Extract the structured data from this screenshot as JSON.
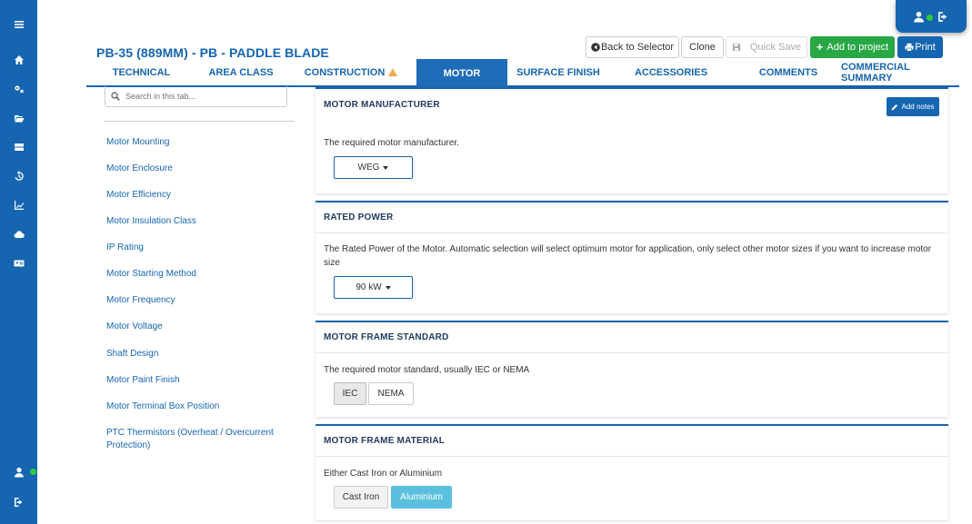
{
  "header": {
    "title": "PB-35 (889MM) - PB - PADDLE BLADE"
  },
  "toolbar": {
    "back_label": "Back to Selector",
    "clone_label": "Clone",
    "quick_save_label": "Quick Save",
    "add_to_project_label": "Add to project",
    "print_label": "Print"
  },
  "tabs": [
    {
      "label": "TECHNICAL"
    },
    {
      "label": "AREA CLASS"
    },
    {
      "label": "CONSTRUCTION"
    },
    {
      "label": "MOTOR"
    },
    {
      "label": "SURFACE FINISH"
    },
    {
      "label": "ACCESSORIES"
    },
    {
      "label": "COMMENTS"
    },
    {
      "label": "COMMERCIAL SUMMARY"
    }
  ],
  "sidebar": {
    "search_placeholder": "Search in this tab...",
    "items": [
      {
        "label": "Motor Mounting"
      },
      {
        "label": "Motor Enclosure"
      },
      {
        "label": "Motor Efficiency"
      },
      {
        "label": "Motor Insulation Class"
      },
      {
        "label": "IP Rating"
      },
      {
        "label": "Motor Starting Method"
      },
      {
        "label": "Motor Frequency"
      },
      {
        "label": "Motor Voltage"
      },
      {
        "label": "Shaft Design"
      },
      {
        "label": "Motor Paint Finish"
      },
      {
        "label": "Motor Terminal Box Position"
      },
      {
        "label": "PTC Thermistors (Overheat / Overcurrent Protection)"
      }
    ]
  },
  "sections": {
    "manufacturer": {
      "title": "MOTOR MANUFACTURER",
      "add_notes_label": "Add notes",
      "description": "The required motor manufacturer.",
      "selected": "WEG"
    },
    "rated_power": {
      "title": "RATED POWER",
      "description": "The Rated Power of the Motor. Automatic selection will select optimum motor for application, only select other motor sizes if you want to increase motor size",
      "selected": "90 kW"
    },
    "frame_standard": {
      "title": "MOTOR FRAME STANDARD",
      "description": "The required motor standard, usually IEC or NEMA",
      "options": [
        "IEC",
        "NEMA"
      ],
      "selected": "IEC"
    },
    "frame_material": {
      "title": "MOTOR FRAME MATERIAL",
      "description": "Either Cast Iron or Aluminium",
      "options": [
        "Cast Iron",
        "Aluminium"
      ],
      "selected": "Aluminium"
    }
  },
  "colors": {
    "brand": "#1565b0",
    "success": "#28a745",
    "selected_option": "#5bc0de",
    "warning": "#f0ad4e",
    "online": "#2ecc40"
  }
}
